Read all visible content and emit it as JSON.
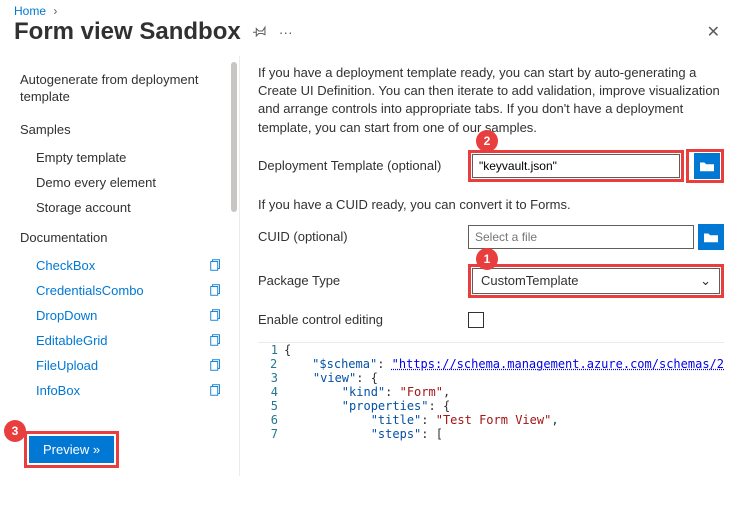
{
  "breadcrumb": {
    "home": "Home"
  },
  "title": "Form view Sandbox",
  "sidebar": {
    "autogen": "Autogenerate from deployment template",
    "samples_head": "Samples",
    "samples": [
      "Empty template",
      "Demo every element",
      "Storage account"
    ],
    "docs_head": "Documentation",
    "docs": [
      "CheckBox",
      "CredentialsCombo",
      "DropDown",
      "EditableGrid",
      "FileUpload",
      "InfoBox"
    ]
  },
  "preview_label": "Preview »",
  "intro": "If you have a deployment template ready, you can start by auto-generating a Create UI Definition. You can then iterate to add validation, improve visualization and arrange controls into appropriate tabs. If you don't have a deployment template, you can start from one of our samples.",
  "row_dt_label": "Deployment Template (optional)",
  "row_dt_value": "\"keyvault.json\"",
  "cuid_note": "If you have a CUID ready, you can convert it to Forms.",
  "row_cuid_label": "CUID (optional)",
  "row_cuid_placeholder": "Select a file",
  "row_pkg_label": "Package Type",
  "row_pkg_value": "CustomTemplate",
  "row_enable_label": "Enable control editing",
  "callouts": {
    "c1": "1",
    "c2": "2",
    "c3": "3"
  },
  "code": {
    "l1": "{",
    "l2a": "    \"$schema\"",
    "l2b": ": ",
    "l2c": "\"https://schema.management.azure.com/schemas/2",
    "l3a": "    \"view\"",
    "l3b": ": {",
    "l4a": "        \"kind\"",
    "l4b": ": ",
    "l4c": "\"Form\"",
    "l4d": ",",
    "l5a": "        \"properties\"",
    "l5b": ": {",
    "l6a": "            \"title\"",
    "l6b": ": ",
    "l6c": "\"Test Form View\"",
    "l6d": ",",
    "l7a": "            \"steps\"",
    "l7b": ": ["
  }
}
